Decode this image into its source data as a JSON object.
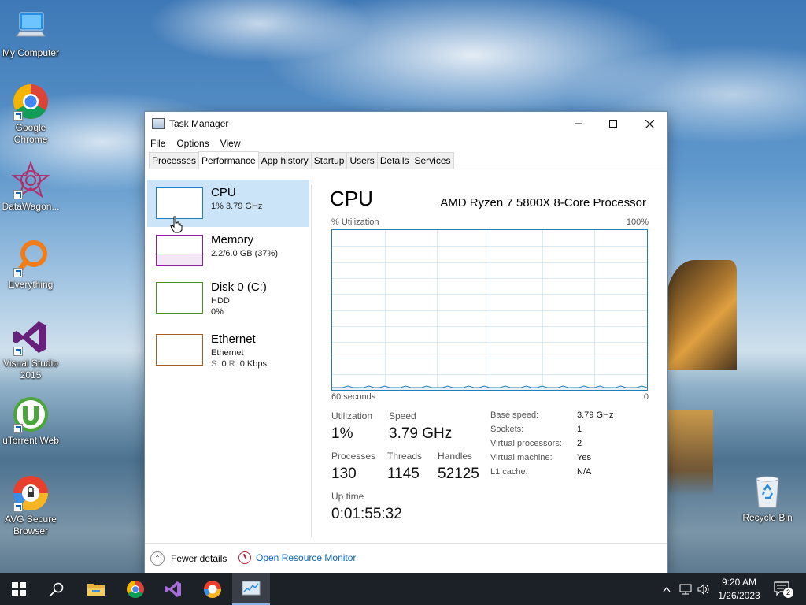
{
  "desktop": {
    "icons": [
      {
        "label": "My Computer",
        "icon": "computer-icon"
      },
      {
        "label": "Google Chrome",
        "icon": "chrome-icon"
      },
      {
        "label": "DataWagon...",
        "icon": "datawagon-icon"
      },
      {
        "label": "Everything",
        "icon": "search-icon"
      },
      {
        "label": "Visual Studio 2015",
        "icon": "visual-studio-icon"
      },
      {
        "label": "uTorrent Web",
        "icon": "utorrent-icon"
      },
      {
        "label": "AVG Secure Browser",
        "icon": "avg-browser-icon"
      },
      {
        "label": "Recycle Bin",
        "icon": "recycle-bin-icon"
      }
    ]
  },
  "window": {
    "title": "Task Manager",
    "menu": [
      "File",
      "Options",
      "View"
    ],
    "tabs": [
      "Processes",
      "Performance",
      "App history",
      "Startup",
      "Users",
      "Details",
      "Services"
    ],
    "active_tab": "Performance",
    "resources": [
      {
        "name": "CPU",
        "line1": "1%  3.79 GHz",
        "line2": "",
        "color": "#1f7fb8",
        "selected": true
      },
      {
        "name": "Memory",
        "line1": "2.2/6.0 GB (37%)",
        "line2": "",
        "color": "#8b1fa0",
        "selected": false
      },
      {
        "name": "Disk 0 (C:)",
        "line1": "HDD",
        "line2": "0%",
        "color": "#4d8f1a",
        "selected": false
      },
      {
        "name": "Ethernet",
        "line1": "Ethernet",
        "line2_s": "S:",
        "line2_sv": "0",
        "line2_r": "R:",
        "line2_rv": "0 Kbps",
        "color": "#a65e1e",
        "selected": false
      }
    ],
    "cpu": {
      "title": "CPU",
      "model": "AMD Ryzen 7 5800X 8-Core Processor",
      "util_label": "% Utilization",
      "util_max": "100%",
      "axis_left": "60 seconds",
      "axis_right": "0",
      "stats": {
        "utilization_label": "Utilization",
        "utilization": "1%",
        "speed_label": "Speed",
        "speed": "3.79 GHz",
        "processes_label": "Processes",
        "processes": "130",
        "threads_label": "Threads",
        "threads": "1145",
        "handles_label": "Handles",
        "handles": "52125",
        "uptime_label": "Up time",
        "uptime": "0:01:55:32"
      },
      "specs": [
        {
          "label": "Base speed:",
          "value": "3.79 GHz"
        },
        {
          "label": "Sockets:",
          "value": "1"
        },
        {
          "label": "Virtual processors:",
          "value": "2"
        },
        {
          "label": "Virtual machine:",
          "value": "Yes"
        },
        {
          "label": "L1 cache:",
          "value": "N/A"
        }
      ],
      "history_percent": [
        1,
        1,
        1,
        2,
        1,
        1,
        1,
        2,
        1,
        1,
        2,
        1,
        1,
        1,
        2,
        1,
        1,
        1,
        2,
        1,
        1,
        1,
        2,
        1,
        1,
        1,
        2,
        1,
        1,
        2,
        1,
        1,
        1,
        2,
        1,
        1,
        1,
        2,
        1,
        1,
        2,
        1,
        1,
        1,
        2,
        1,
        1,
        1,
        2,
        1,
        1,
        2,
        1,
        1,
        1,
        2,
        1,
        1,
        1,
        2,
        1
      ]
    },
    "footer": {
      "fewer_details": "Fewer details",
      "resource_monitor": "Open Resource Monitor"
    }
  },
  "taskbar": {
    "pinned": [
      "start-icon",
      "search-icon",
      "file-explorer-icon",
      "chrome-icon",
      "visual-studio-icon",
      "avg-browser-icon",
      "task-manager-icon"
    ],
    "clock_time": "9:20 AM",
    "clock_date": "1/26/2023",
    "notification_count": "2"
  }
}
